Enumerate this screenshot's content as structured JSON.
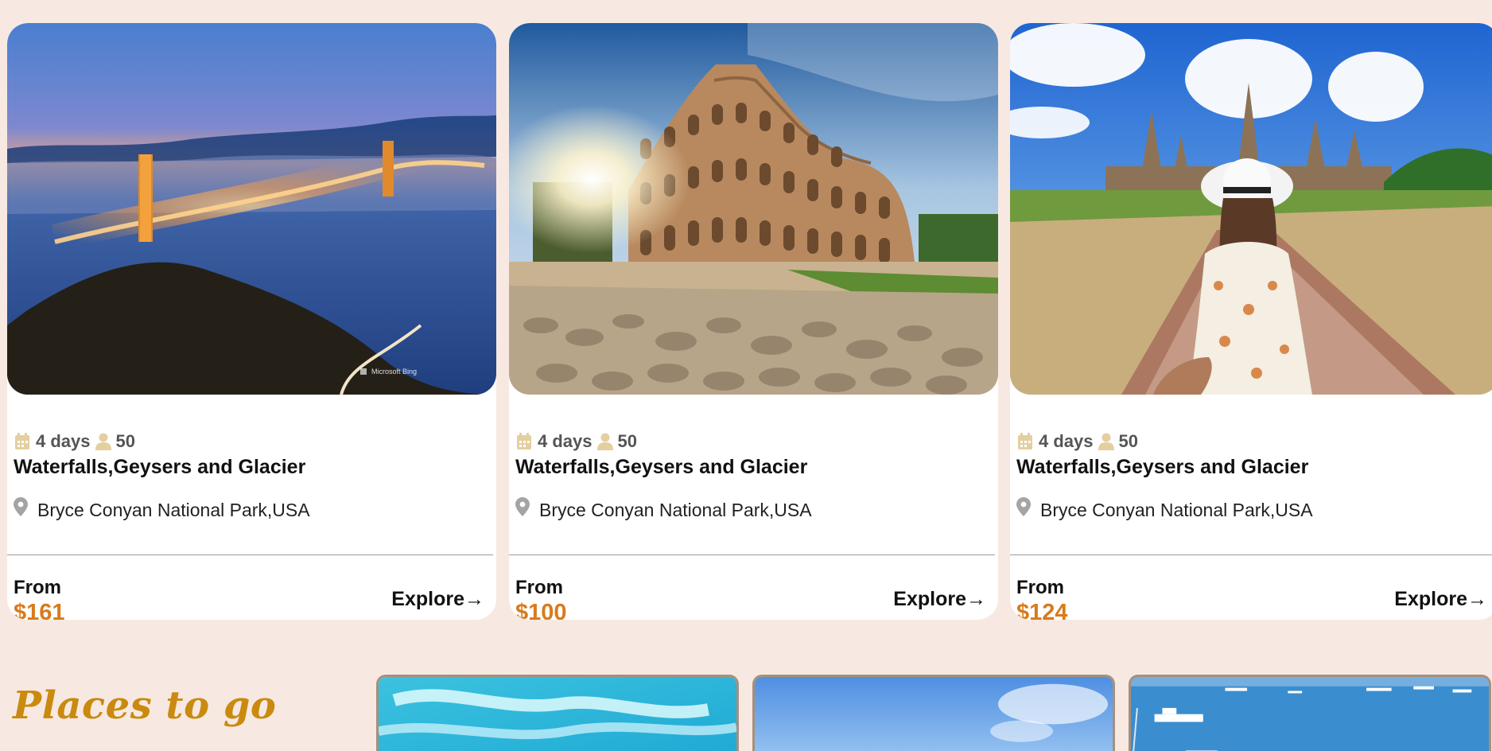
{
  "tours": [
    {
      "duration": "4 days",
      "group_size": "50",
      "title": "Waterfalls,Geysers and Glacier",
      "location": "Bryce Conyan National Park,USA",
      "from_label": "From",
      "price": "$161",
      "explore_label": "Explore→",
      "image_icon": "golden-gate-bridge-image",
      "watermark": "Microsoft Bing"
    },
    {
      "duration": "4 days",
      "group_size": "50",
      "title": "Waterfalls,Geysers and Glacier",
      "location": "Bryce Conyan National Park,USA",
      "from_label": "From",
      "price": "$100",
      "explore_label": "Explore→",
      "image_icon": "colosseum-image"
    },
    {
      "duration": "4 days",
      "group_size": "50",
      "title": "Waterfalls,Geysers and Glacier",
      "location": "Bryce Conyan National Park,USA",
      "from_label": "From",
      "price": "$124",
      "explore_label": "Explore→",
      "image_icon": "temple-traveler-image"
    }
  ],
  "places": {
    "title": "Places to go",
    "thumbnails": [
      "turquoise-sky-image",
      "blue-sky-image",
      "sea-port-image"
    ]
  },
  "colors": {
    "background": "#f7e9e2",
    "card": "#ffffff",
    "price": "#d97a1b",
    "icon": "#e4cfa0",
    "places_title": "#c98a0f"
  },
  "icons": {
    "calendar": "calendar-icon",
    "person": "person-icon",
    "location": "location-pin-icon"
  }
}
